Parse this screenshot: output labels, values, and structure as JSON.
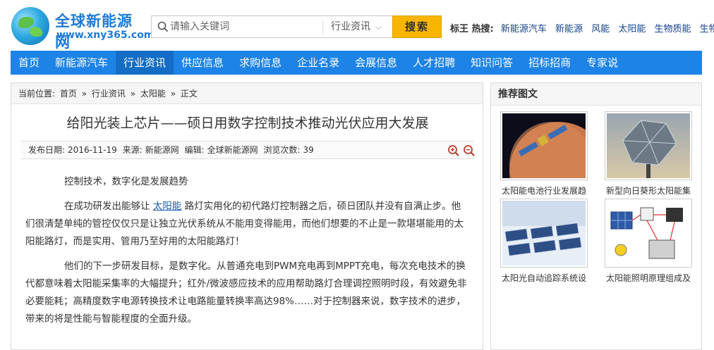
{
  "logo": {
    "title": "全球新能源网",
    "url": "www.xny365.com"
  },
  "search": {
    "placeholder": "请输入关键词",
    "category": "行业资讯",
    "button": "搜索"
  },
  "hot": {
    "label": "标王 热搜:",
    "links": [
      "新能源汽车",
      "新能源",
      "风能",
      "太阳能",
      "生物质能",
      "生物燃"
    ]
  },
  "nav": {
    "items": [
      "首页",
      "新能源汽车",
      "行业资讯",
      "供应信息",
      "求购信息",
      "企业名录",
      "会展信息",
      "人才招聘",
      "知识问答",
      "招标招商",
      "专家说"
    ],
    "active_index": 2
  },
  "breadcrumb": {
    "prefix": "当前位置:",
    "items": [
      "首页",
      "行业资讯",
      "太阳能",
      "正文"
    ],
    "sep": "»"
  },
  "article": {
    "title": "给阳光装上芯片——硕日用数字控制技术推动光伏应用大发展",
    "meta": {
      "date_label": "发布日期:",
      "date": "2016-11-19",
      "source_label": "来源:",
      "source": "新能源网",
      "editor_label": "编辑:",
      "editor": "全球新能源网",
      "views_label": "浏览次数:",
      "views": "39"
    },
    "p1": "控制技术，数字化是发展趋势",
    "p2_before": "在成功研发出能够让 ",
    "p2_link": "太阳能",
    "p2_after": " 路灯实用化的初代路灯控制器之后，硕日团队并没有自满止步。他们很清楚单纯的管控仅仅只是让独立光伏系统从不能用变得能用，而他们想要的不止是一款堪堪能用的太阳能路灯，而是实用、管用乃至好用的太阳能路灯！",
    "p3": "他们的下一步研发目标，是数字化。从普通充电到PWM充电再到MPPT充电，每次充电技术的换代都意味着太阳能采集率的大幅提升；红外/微波感应技术的应用帮助路灯合理调控照明时段，有效避免非必要能耗；高精度数字电源转换技术让电路能量转换率高达98%……对于控制器来说，数字技术的进步，带来的将是性能与智能程度的全面升级。"
  },
  "sidebar": {
    "heading": "推荐图文",
    "items": [
      {
        "caption": "太阳能电池行业发展趋"
      },
      {
        "caption": "新型向日葵形太阳能集"
      },
      {
        "caption": "太阳光自动追踪系统设"
      },
      {
        "caption": "太阳能照明原理组成及"
      }
    ]
  },
  "colors": {
    "nav": "#1e83e6",
    "nav_active": "#136dc4",
    "search_button": "#f7b500",
    "link": "#15428b"
  }
}
